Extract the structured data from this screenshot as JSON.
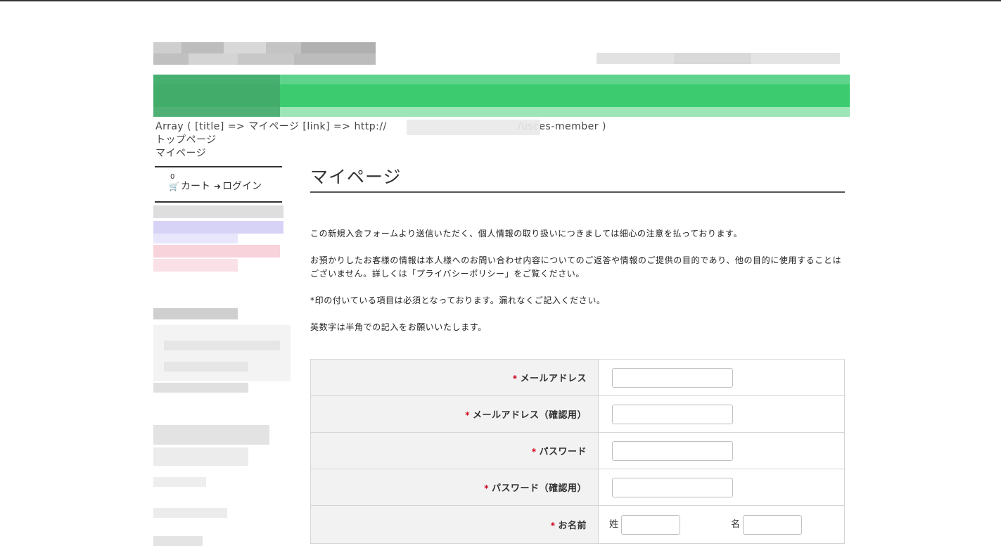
{
  "breadcrumb": {
    "debug_prefix": "Array ( [title] => マイページ [link] => http://",
    "debug_suffix": "/usces-member )",
    "top": "トップページ",
    "current": "マイページ"
  },
  "sidebar": {
    "cart_count": "0",
    "cart_label": "カート",
    "login_label": "ログイン",
    "cart_icon": "cart-icon",
    "login_icon": "login-icon"
  },
  "main": {
    "title": "マイページ",
    "paragraphs": [
      "この新規入会フォームより送信いただく、個人情報の取り扱いにつきましては細心の注意を払っております。",
      "お預かりしたお客様の情報は本人様へのお問い合わせ内容についてのご返答や情報のご提供の目的であり、他の目的に使用することはございません。詳しくは「プライバシーポリシー」をご覧ください。",
      "*印の付いている項目は必須となっております。漏れなくご記入ください。",
      "英数字は半角での記入をお願いいたします。"
    ]
  },
  "form": {
    "required_mark": "*",
    "fields": [
      {
        "label": "メールアドレス",
        "value": ""
      },
      {
        "label": "メールアドレス（確認用）",
        "value": ""
      },
      {
        "label": "パスワード",
        "value": ""
      },
      {
        "label": "パスワード（確認用）",
        "value": ""
      }
    ],
    "name": {
      "label": "お名前",
      "last_label": "姓",
      "first_label": "名",
      "last_value": "",
      "first_value": ""
    }
  },
  "colors": {
    "banner": "#3ccb6f",
    "required": "#d0021b"
  }
}
